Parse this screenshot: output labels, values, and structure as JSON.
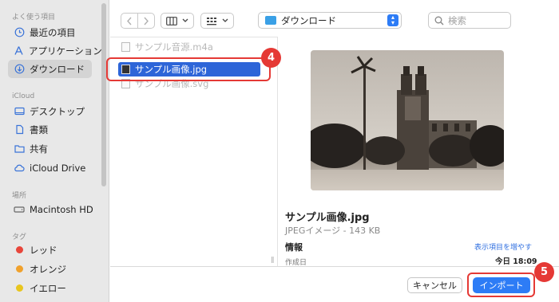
{
  "sidebar": {
    "favorites_header": "よく使う項目",
    "favorites": [
      {
        "label": "最近の項目",
        "icon": "clock-icon"
      },
      {
        "label": "アプリケーション",
        "icon": "apps-icon"
      },
      {
        "label": "ダウンロード",
        "icon": "download-icon",
        "selected": true
      }
    ],
    "icloud_header": "iCloud",
    "icloud": [
      {
        "label": "デスクトップ",
        "icon": "desktop-icon"
      },
      {
        "label": "書類",
        "icon": "document-icon"
      },
      {
        "label": "共有",
        "icon": "shared-folder-icon"
      },
      {
        "label": "iCloud Drive",
        "icon": "cloud-icon"
      }
    ],
    "locations_header": "場所",
    "locations": [
      {
        "label": "Macintosh HD",
        "icon": "drive-icon"
      }
    ],
    "tags_header": "タグ",
    "tags": [
      {
        "label": "レッド",
        "color": "#e8463b"
      },
      {
        "label": "オレンジ",
        "color": "#f0a12c"
      },
      {
        "label": "イエロー",
        "color": "#e8c51e"
      }
    ]
  },
  "toolbar": {
    "location_label": "ダウンロード",
    "search_placeholder": "検索"
  },
  "files": [
    {
      "name": "サンプル音源.m4a",
      "state": "dim"
    },
    {
      "name": "サンプル画像.jpg",
      "state": "selected"
    },
    {
      "name": "サンプル画像.svg",
      "state": "dim"
    }
  ],
  "callouts": {
    "step4": "4",
    "step5": "5",
    "accent": "#e53935"
  },
  "preview": {
    "title": "サンプル画像.jpg",
    "subtitle": "JPEGイメージ - 143 KB",
    "info_label": "情報",
    "show_more": "表示項目を増やす",
    "created_label": "作成日",
    "created_value": "今日 18:09"
  },
  "buttons": {
    "cancel": "キャンセル",
    "import": "インポート"
  },
  "colors": {
    "accent": "#2d7cf6",
    "selection": "#2d65d8"
  }
}
